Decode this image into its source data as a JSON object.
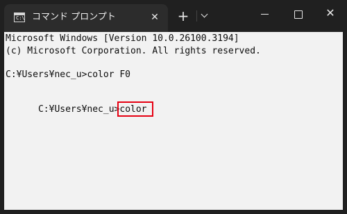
{
  "window": {
    "tab_title": "コマンド プロンプト",
    "tab_icon_glyph": "C:\\",
    "tab_close": "✕",
    "new_tab": "+",
    "close": "✕"
  },
  "terminal": {
    "lines": [
      "Microsoft Windows [Version 10.0.26100.3194]",
      "(c) Microsoft Corporation. All rights reserved.",
      "C:¥Users¥nec_u>color F0"
    ],
    "prompt": "C:¥Users¥nec_u>",
    "command": "color",
    "background_color": "#f2f2f2",
    "text_color": "#0c0c0c",
    "highlight_color": "#e60012"
  }
}
